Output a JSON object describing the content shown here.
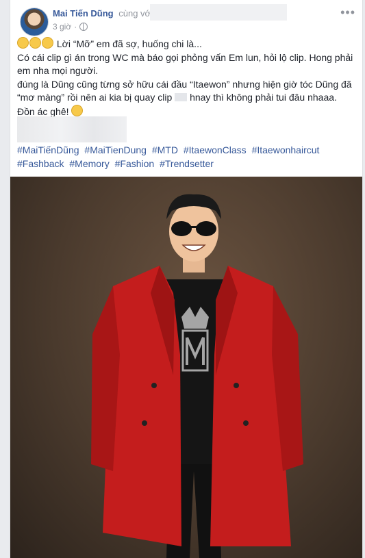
{
  "post": {
    "author": "Mai Tiến Dũng",
    "with_text": "cùng vớ",
    "time": "3 giờ",
    "more_icon": "more-dots-icon",
    "privacy_icon": "globe-icon",
    "paragraphs": [
      "Lời “Mỡ” em đã sợ, huống chi là...",
      "Có cái clip gì án trong WC mà báo gọi phỏng vấn Em lun, hỏi lộ clip. Hong phải em nha mọi người.",
      "đúng là Dũng cũng từng sở hữu cái đầu “Itaewon” nhưng hiện giờ tóc Dũng đã “mơ màng” rồi nên ai kia bị quay clip",
      "hnay thì không phải tui đâu nhaaa.",
      "Đồn ác ghê!"
    ],
    "hashtags": [
      "#MaiTiếnDũng",
      "#MaiTienDung",
      "#MTD",
      "#ItaewonClass",
      "#Itaewonhaircut",
      "#Fashback",
      "#Memory",
      "#Fashion",
      "#Trendsetter"
    ],
    "colors": {
      "link": "#365899",
      "coat": "#c41d1d",
      "background": "#4a3a2d"
    }
  }
}
